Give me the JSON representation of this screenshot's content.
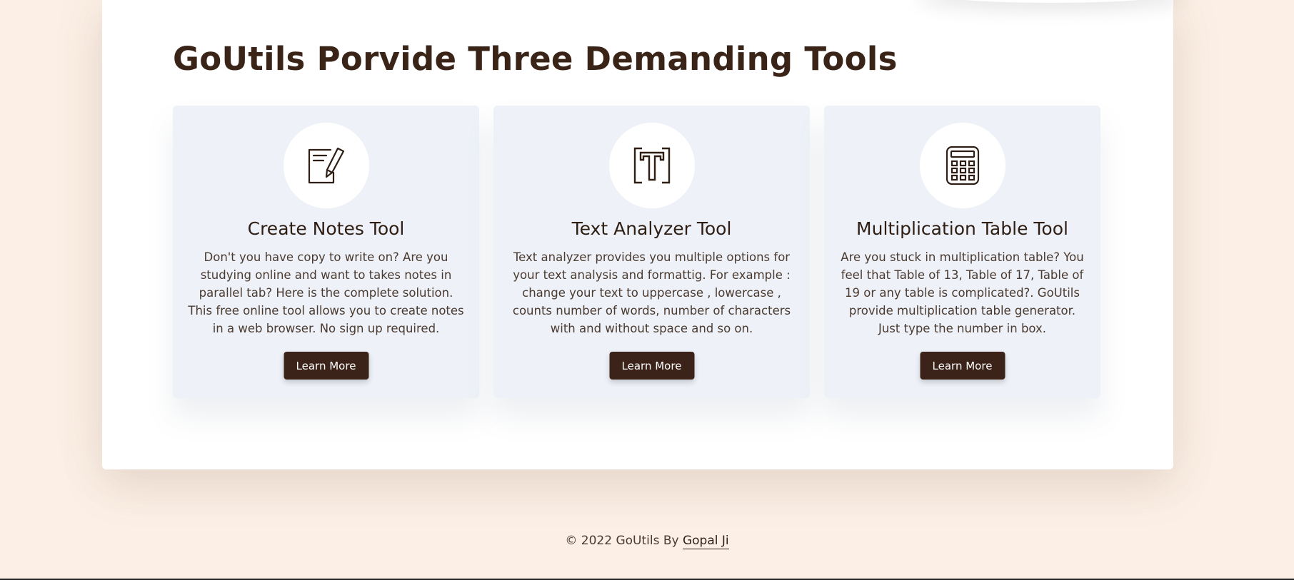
{
  "section": {
    "heading": "GoUtils Porvide Three Demanding Tools"
  },
  "cards": [
    {
      "icon": "notes-pen-icon",
      "title": "Create Notes Tool",
      "description": "Don't you have copy to write on? Are you studying online and want to takes notes in parallel tab? Here is the complete solution. This free online tool allows you to create notes in a web browser. No sign up required.",
      "button_label": "Learn More"
    },
    {
      "icon": "text-t-icon",
      "title": "Text Analyzer Tool",
      "description": "Text analyzer provides you multiple options for your text analysis and formattig. For example : change your text to uppercase , lowercase , counts number of words, number of characters with and without space and so on.",
      "button_label": "Learn More"
    },
    {
      "icon": "calculator-icon",
      "title": "Multiplication Table Tool",
      "description": "Are you stuck in multiplication table? You feel that Table of 13, Table of 17, Table of 19 or any table is complicated?. GoUtils provide multiplication table generator. Just type the number in box.",
      "button_label": "Learn More"
    }
  ],
  "footer": {
    "copyright": "© 2022 GoUtils By",
    "author_link": "Gopal Ji"
  },
  "colors": {
    "page_background": "#fcf0e6",
    "card_background": "#eef2f8",
    "accent_dark": "#3b2319"
  }
}
